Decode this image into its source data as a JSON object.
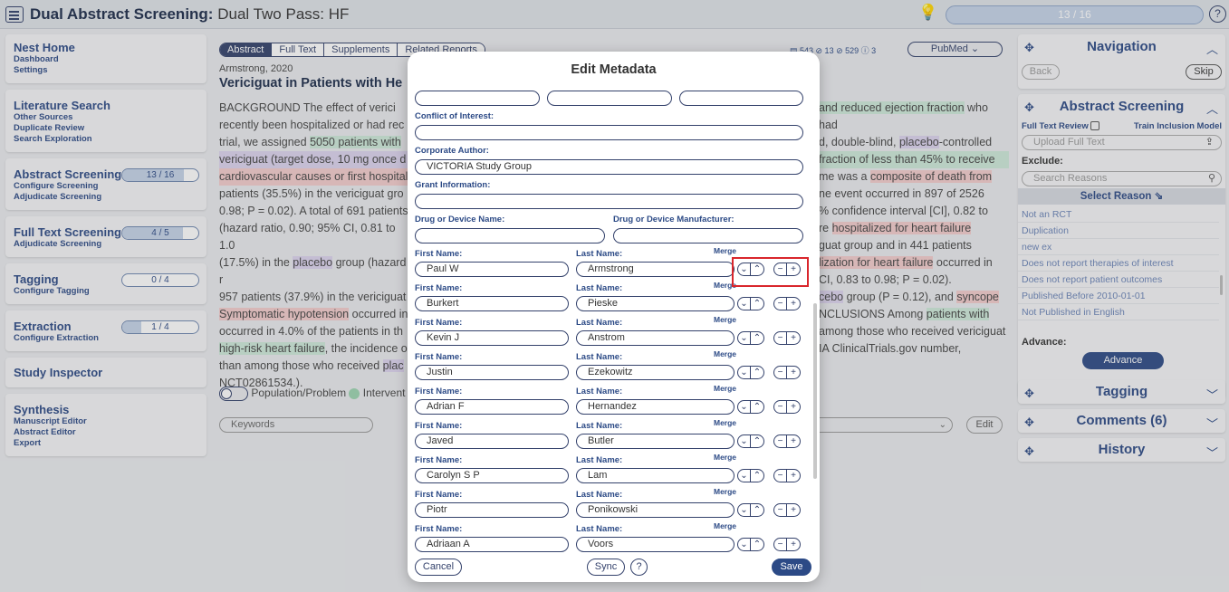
{
  "topbar": {
    "title_bold": "Dual Abstract Screening:",
    "title_rest": " Dual Two Pass: HF",
    "progress_label": "13 / 16",
    "progress_fraction": 0.8125,
    "help": "?"
  },
  "sidebar": {
    "nest_home": {
      "title": "Nest Home",
      "items": [
        "Dashboard",
        "Settings"
      ]
    },
    "literature_search": {
      "title": "Literature Search",
      "items": [
        "Other Sources",
        "Duplicate Review",
        "Search Exploration"
      ]
    },
    "abstract_screening": {
      "title": "Abstract Screening",
      "progress": "13 / 16",
      "fraction": 0.8125,
      "items": [
        "Configure Screening",
        "Adjudicate Screening"
      ]
    },
    "full_text_screening": {
      "title": "Full Text Screening",
      "progress": "4 / 5",
      "fraction": 0.8,
      "items": [
        "Adjudicate Screening"
      ]
    },
    "tagging": {
      "title": "Tagging",
      "progress": "0 / 4",
      "fraction": 0,
      "items": [
        "Configure Tagging"
      ]
    },
    "extraction": {
      "title": "Extraction",
      "progress": "1 / 4",
      "fraction": 0.25,
      "items": [
        "Configure Extraction"
      ]
    },
    "study_inspector": {
      "title": "Study Inspector"
    },
    "synthesis": {
      "title": "Synthesis",
      "items": [
        "Manuscript Editor",
        "Abstract Editor",
        "Export"
      ]
    }
  },
  "main": {
    "tabs": [
      "Abstract",
      "Full Text",
      "Supplements",
      "Related Reports"
    ],
    "counts": "▤ 543  ⊘ 13  ⊘ 529  ⓘ 3",
    "source": "PubMed",
    "author_year": "Armstrong, 2020",
    "title": "Vericiguat in Patients with He",
    "abstract_left": [
      "BACKGROUND The effect of verici",
      "recently been hospitalized or had rec",
      "trial, we assigned ",
      "5050 patients with",
      "vericiguat (target dose, 10 mg once d",
      "cardiovascular causes or first hospital",
      "patients (35.5%) in the vericiguat gro",
      "0.98; P = 0.02). A total of 691 patients",
      "(hazard ratio, 0.90; 95% CI, 0.81 to 1.0",
      "(17.5%) in the ",
      "placebo",
      " group (hazard r",
      "957 patients (37.9%) in the vericiguat",
      "Symptomatic hypotension",
      " occurred in",
      "occurred in 4.0% of the patients in th",
      "high-risk heart failure",
      ", the incidence o",
      "than among those who received ",
      "plac",
      "NCT02861534.)."
    ],
    "abstract_right": [
      "and reduced ejection fraction",
      " who had",
      "d, double-blind, ",
      "placebo",
      "-controlled",
      "fraction of less than 45% to receive",
      "me was a ",
      "composite of death from",
      "ne event occurred in 897 of 2526",
      "% confidence interval [CI], 0.82 to",
      "re ",
      "hospitalized for heart failure",
      "guat group and in 441 patients",
      "lization for heart failure",
      " occurred in",
      "CI, 0.83 to 0.98; P = 0.02).",
      "cebo",
      " group (P = 0.12), and ",
      "syncope",
      "NCLUSIONS Among ",
      "patients with",
      "among those who received vericiguat",
      "IA ClinicalTrials.gov number,"
    ],
    "toggle_labels": [
      "Population/Problem",
      "Intervent"
    ],
    "keywords_placeholder": "Keywords",
    "edit_label": "Edit"
  },
  "right": {
    "navigation": {
      "title": "Navigation",
      "back": "Back",
      "skip": "Skip"
    },
    "abstract_screening": {
      "title": "Abstract Screening",
      "full_text_review": "Full Text Review",
      "train": "Train Inclusion Model",
      "upload": "Upload Full Text",
      "exclude_label": "Exclude:",
      "search_placeholder": "Search Reasons",
      "select_reason": "Select Reason ⇘",
      "reasons": [
        "Not an RCT",
        "Duplication",
        "new ex",
        "Does not report therapies of interest",
        "Does not report patient outcomes",
        "Published Before 2010-01-01",
        "Not Published in English"
      ],
      "advance_label": "Advance:",
      "advance_button": "Advance"
    },
    "tagging": {
      "title": "Tagging"
    },
    "comments": {
      "title": "Comments (6)"
    },
    "history": {
      "title": "History"
    }
  },
  "modal": {
    "title": "Edit Metadata",
    "coi_label": "Conflict of Interest:",
    "corporate_author_label": "Corporate Author:",
    "corporate_author_value": "VICTORIA Study Group",
    "grant_label": "Grant Information:",
    "drug_name_label": "Drug or Device Name:",
    "drug_manufacturer_label": "Drug or Device Manufacturer:",
    "first_name_label": "First Name:",
    "last_name_label": "Last Name:",
    "merge_label": "Merge",
    "authors": [
      {
        "first": "Paul W",
        "last": "Armstrong"
      },
      {
        "first": "Burkert",
        "last": "Pieske"
      },
      {
        "first": "Kevin J",
        "last": "Anstrom"
      },
      {
        "first": "Justin",
        "last": "Ezekowitz"
      },
      {
        "first": "Adrian F",
        "last": "Hernandez"
      },
      {
        "first": "Javed",
        "last": "Butler"
      },
      {
        "first": "Carolyn S P",
        "last": "Lam"
      },
      {
        "first": "Piotr",
        "last": "Ponikowski"
      },
      {
        "first": "Adriaan A",
        "last": "Voors"
      }
    ],
    "cancel": "Cancel",
    "sync": "Sync",
    "help": "?",
    "save": "Save"
  }
}
